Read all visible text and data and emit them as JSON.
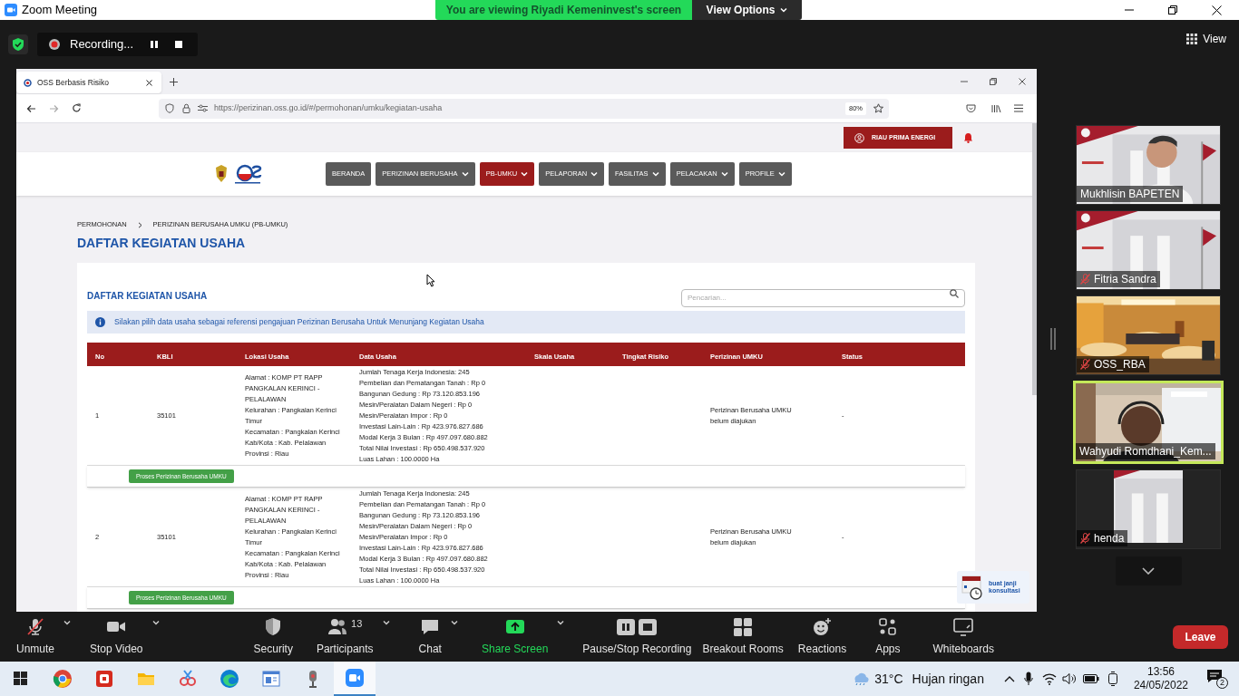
{
  "window": {
    "title": "Zoom Meeting"
  },
  "share_banner": {
    "text": "You are viewing Riyadi Kemeninvest's screen",
    "view_options": "View Options"
  },
  "recording": {
    "label": "Recording..."
  },
  "view_button": "View",
  "browser": {
    "tab": "OSS Berbasis Risiko",
    "url": "https://perizinan.oss.go.id/#/permohonan/umku/kegiatan-usaha",
    "zoom": "80%"
  },
  "page": {
    "account": "RIAU PRIMA ENERGI",
    "nav": [
      {
        "label": "BERANDA",
        "dropdown": false,
        "selected": false
      },
      {
        "label": "PERIZINAN BERUSAHA",
        "dropdown": true,
        "selected": false
      },
      {
        "label": "PB-UMKU",
        "dropdown": true,
        "selected": true
      },
      {
        "label": "PELAPORAN",
        "dropdown": true,
        "selected": false
      },
      {
        "label": "FASILITAS",
        "dropdown": true,
        "selected": false
      },
      {
        "label": "PELACAKAN",
        "dropdown": true,
        "selected": false
      },
      {
        "label": "PROFILE",
        "dropdown": true,
        "selected": false
      }
    ],
    "breadcrumb": [
      "PERMOHONAN",
      "PERIZINAN BERUSAHA UMKU (PB-UMKU)"
    ],
    "heading": "DAFTAR KEGIATAN USAHA",
    "card_title": "DAFTAR KEGIATAN USAHA",
    "search_placeholder": "Pencarian...",
    "info": "Silakan pilih data usaha sebagai referensi pengajuan Perizinan Berusaha Untuk Menunjang Kegiatan Usaha",
    "table": {
      "columns": [
        "No",
        "KBLI",
        "Lokasi Usaha",
        "Data Usaha",
        "Skala Usaha",
        "Tingkat Risiko",
        "Perizinan UMKU",
        "Status"
      ],
      "rows": [
        {
          "no": "1",
          "kbli": "35101",
          "lokasi": [
            "Alamat : KOMP PT RAPP PANGKALAN KERINCI - PELALAWAN",
            "Kelurahan : Pangkalan Kerinci Timur",
            "Kecamatan : Pangkalan Kerinci",
            "Kab/Kota : Kab. Pelalawan",
            "Provinsi : Riau"
          ],
          "data": [
            "Jumlah Tenaga Kerja Indonesia: 245",
            "Pembelian dan Pematangan Tanah : Rp 0",
            "Bangunan Gedung : Rp 73.120.853.196",
            "Mesin/Peralatan Dalam Negeri : Rp 0",
            "Mesin/Peralatan Impor : Rp 0",
            "Investasi Lain-Lain : Rp 423.976.827.686",
            "Modal Kerja 3 Bulan : Rp 497.097.680.882",
            "Total Nilai Investasi : Rp 650.498.537.920",
            "Luas Lahan : 100.0000 Ha"
          ],
          "perizinan": "Perizinan Berusaha UMKU belum diajukan",
          "status": "-",
          "action": "Proses Perizinan Berusaha UMKU"
        },
        {
          "no": "2",
          "kbli": "35101",
          "lokasi": [
            "Alamat : KOMP PT RAPP PANGKALAN KERINCI - PELALAWAN",
            "Kelurahan : Pangkalan Kerinci Timur",
            "Kecamatan : Pangkalan Kerinci",
            "Kab/Kota : Kab. Pelalawan",
            "Provinsi : Riau"
          ],
          "data": [
            "Jumlah Tenaga Kerja Indonesia: 245",
            "Pembelian dan Pematangan Tanah : Rp 0",
            "Bangunan Gedung : Rp 73.120.853.196",
            "Mesin/Peralatan Dalam Negeri : Rp 0",
            "Mesin/Peralatan Impor : Rp 0",
            "Investasi Lain-Lain : Rp 423.976.827.686",
            "Modal Kerja 3 Bulan : Rp 497.097.680.882",
            "Total Nilai Investasi : Rp 650.498.537.920",
            "Luas Lahan : 100.0000 Ha"
          ],
          "perizinan": "Perizinan Berusaha UMKU belum diajukan",
          "status": "-",
          "action": "Proses Perizinan Berusaha UMKU"
        }
      ]
    },
    "consult": [
      "buat janji",
      "konsultasi"
    ]
  },
  "participants": [
    {
      "name": "Mukhlisin BAPETEN",
      "muted": false,
      "active": false
    },
    {
      "name": "Fitria Sandra",
      "muted": true,
      "active": false
    },
    {
      "name": "OSS_RBA",
      "muted": true,
      "active": false
    },
    {
      "name": "Wahyudi Romdhani_Kem...",
      "muted": false,
      "active": true
    },
    {
      "name": "henda",
      "muted": true,
      "active": false
    }
  ],
  "toolbar": [
    {
      "kind": "audio",
      "label": "Unmute",
      "menu": true
    },
    {
      "kind": "video",
      "label": "Stop Video",
      "menu": true
    },
    {
      "kind": "security",
      "label": "Security",
      "menu": false
    },
    {
      "kind": "participants",
      "label": "Participants",
      "count": "13",
      "menu": true
    },
    {
      "kind": "chat",
      "label": "Chat",
      "menu": true
    },
    {
      "kind": "share",
      "label": "Share Screen",
      "menu": true
    },
    {
      "kind": "record",
      "label": "Pause/Stop Recording",
      "menu": false
    },
    {
      "kind": "breakout",
      "label": "Breakout Rooms",
      "menu": false
    },
    {
      "kind": "reactions",
      "label": "Reactions",
      "menu": false
    },
    {
      "kind": "apps",
      "label": "Apps",
      "menu": false
    },
    {
      "kind": "whiteboards",
      "label": "Whiteboards",
      "menu": false
    }
  ],
  "leave": "Leave",
  "taskbar": {
    "apps": [
      {
        "kind": "start",
        "selected": false
      },
      {
        "kind": "chrome",
        "selected": false
      },
      {
        "kind": "vivaldi",
        "selected": false
      },
      {
        "kind": "files",
        "selected": false
      },
      {
        "kind": "snip",
        "selected": false
      },
      {
        "kind": "edge",
        "selected": false
      },
      {
        "kind": "reader",
        "selected": false
      },
      {
        "kind": "recorder",
        "selected": false
      },
      {
        "kind": "zoom",
        "selected": true
      }
    ],
    "temperature": "31°C",
    "weather": "Hujan ringan",
    "time": "13:56",
    "date": "24/05/2022",
    "notifications": "2"
  }
}
